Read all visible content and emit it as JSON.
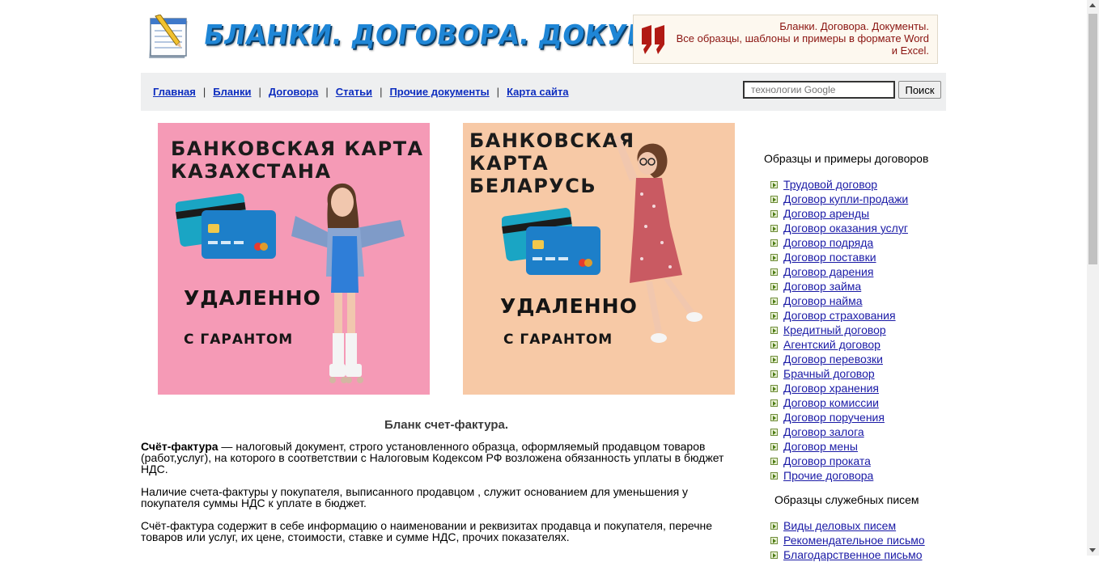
{
  "header": {
    "logo_title": "БЛАНКИ. ДОГОВОРА. ДОКУМЕНТЫ.",
    "tagline_line1": "Бланки. Договора. Документы.",
    "tagline_line2": "Все образцы, шаблоны и примеры в формате Word",
    "tagline_line3": "и Excel."
  },
  "nav": {
    "items": [
      {
        "label": "Главная"
      },
      {
        "label": "Бланки"
      },
      {
        "label": "Договора"
      },
      {
        "label": "Статьи"
      },
      {
        "label": "Прочие документы"
      },
      {
        "label": "Карта сайта"
      }
    ],
    "separator": "|",
    "search_placeholder": "технологии Google",
    "search_button": "Поиск"
  },
  "banners": [
    {
      "title_line1": "БАНКОВСКАЯ КАРТА",
      "title_line2": "КАЗАХСТАНА",
      "remote": "УДАЛЕННО",
      "guarantee": "С ГАРАНТОМ",
      "bg_color": "#f59ab6"
    },
    {
      "title_line1": "БАНКОВСКАЯ",
      "title_line2": "КАРТА",
      "title_line3": "БЕЛАРУСЬ",
      "remote": "УДАЛЕННО",
      "guarantee": "С ГАРАНТОМ",
      "bg_color": "#f7c9a6"
    }
  ],
  "article": {
    "title": "Бланк счет-фактура.",
    "p1_term": "Счёт-фактура",
    "p1_line1": " — налоговый документ, строго установленного образца, оформляемый продавцом товаров",
    "p1_line2": "(работ,услуг), на которого в соответствии с Налоговым Кодексом РФ возложена обязанность уплаты в бюджет",
    "p1_line3": "НДС.",
    "p2_line1": "Наличие счета-фактуры у покупателя, выписанного продавцом , служит основанием для уменьшения у",
    "p2_line2": "покупателя суммы НДС к уплате в бюджет.",
    "p3_line1": "Счёт-фактура содержит в себе информацию о наименовании и реквизитах продавца и покупателя, перечне",
    "p3_line2": "товаров или услуг, их цене, стоимости, ставке и сумме НДС, прочих показателях."
  },
  "sidebar": {
    "contracts_heading": "Образцы и примеры договоров",
    "contracts": [
      "Трудовой договор",
      "Договор купли-продажи",
      "Договор аренды",
      "Договор оказания услуг",
      "Договор подряда",
      "Договор поставки",
      "Договор дарения",
      "Договор займа",
      "Договор найма",
      "Договор страхования",
      "Кредитный договор",
      "Агентский договор",
      "Договор перевозки",
      "Брачный договор",
      "Договор хранения",
      "Договор комиссии",
      "Договор поручения",
      "Договор залога",
      "Договор мены",
      "Договор проката",
      "Прочие договора"
    ],
    "letters_heading": "Образцы служебных писем",
    "letters": [
      "Виды деловых писем",
      "Рекомендательное письмо",
      "Благодарственное письмо"
    ]
  }
}
